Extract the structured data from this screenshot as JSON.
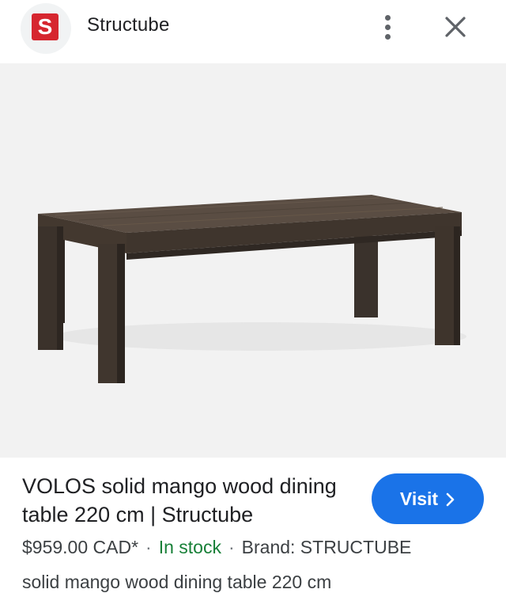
{
  "header": {
    "logo_letter": "S",
    "site_name": "Structube",
    "logo_color": "#d6262f"
  },
  "image": {
    "alt": "VOLOS solid mango wood dining table"
  },
  "product": {
    "title": "VOLOS solid mango wood dining table 220 cm | Structube",
    "price": "$959.00 CAD*",
    "separator": "·",
    "stock": "In stock",
    "brand": "Brand: STRUCTUBE",
    "description": "solid mango wood dining table 220 cm"
  },
  "actions": {
    "visit_label": "Visit",
    "visit_color": "#1a73e8"
  },
  "icons": {
    "more": "more-vert-icon",
    "close": "close-icon",
    "chevron": "chevron-right-icon"
  }
}
